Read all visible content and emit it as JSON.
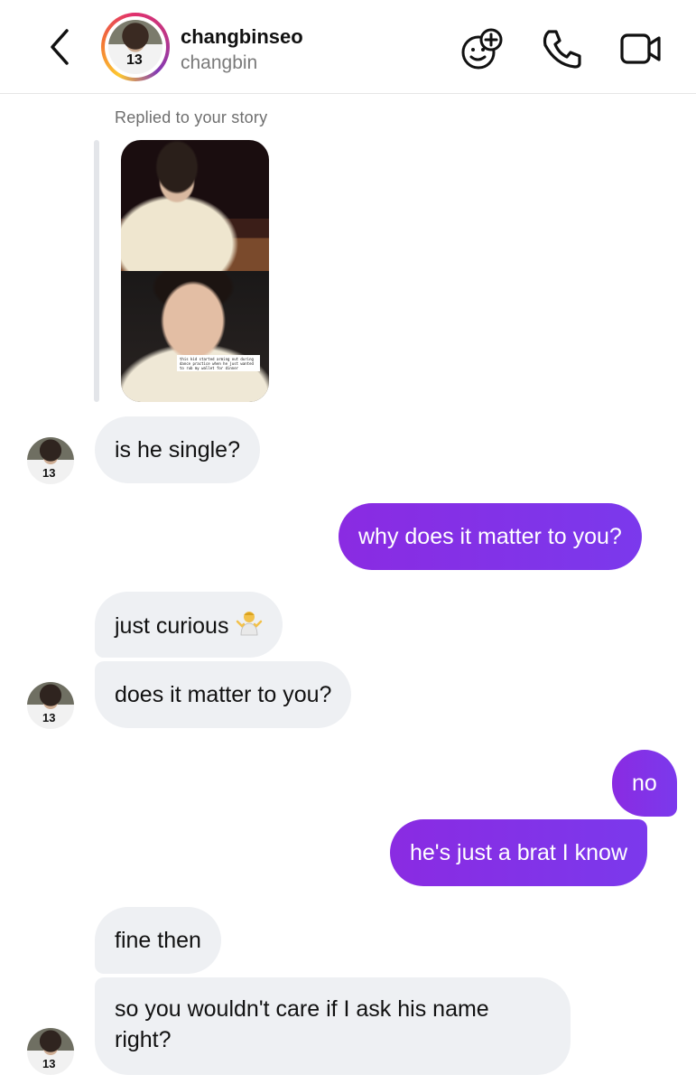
{
  "header": {
    "display_name": "changbinseo",
    "username": "changbin"
  },
  "story": {
    "label": "Replied to your story",
    "caption": "this kid started arming out during dance practice when he just wanted to rub my wallet for dinner"
  },
  "messages": [
    {
      "from": "them",
      "text": "is he single?"
    },
    {
      "from": "me",
      "text": "why does it matter to you?"
    },
    {
      "from": "them",
      "text": "just curious",
      "emoji": "person-shrugging"
    },
    {
      "from": "them",
      "text": "does it matter to you?"
    },
    {
      "from": "me",
      "text": "no"
    },
    {
      "from": "me",
      "text": "he's just a brat I know"
    },
    {
      "from": "them",
      "text": "fine then"
    },
    {
      "from": "them",
      "lines": [
        "so you wouldn't care if I ask his name",
        "right?"
      ]
    }
  ],
  "icons": {
    "back": "chevron-left-icon",
    "effects": "sticker-smiley-plus-icon",
    "call": "phone-icon",
    "video": "video-camera-icon"
  },
  "colors": {
    "outgoing_bubble": "#7b39ec",
    "incoming_bubble": "#eef0f3"
  }
}
